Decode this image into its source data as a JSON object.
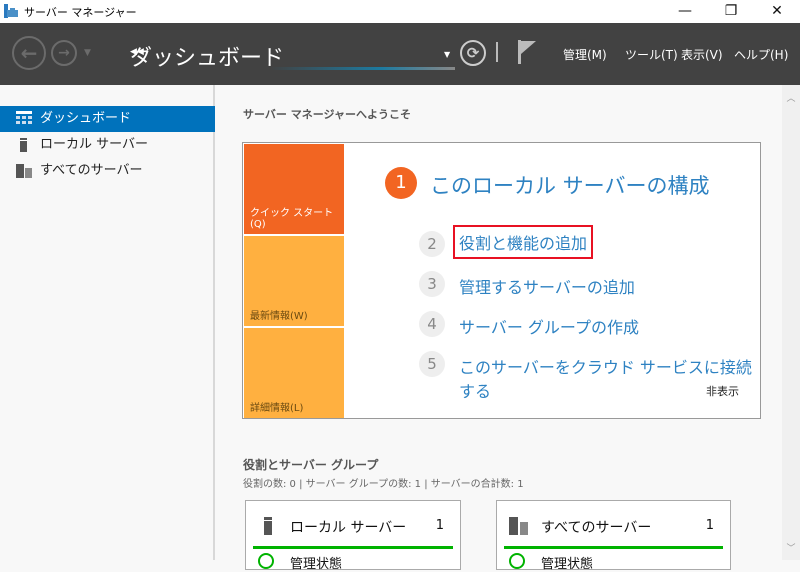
{
  "window": {
    "title": "サーバー マネージャー"
  },
  "toolbar": {
    "breadcrumb": "ダッシュボード",
    "menus": [
      "管理(M)",
      "ツール(T)",
      "表示(V)",
      "ヘルプ(H)"
    ]
  },
  "sidebar": {
    "items": [
      {
        "label": "ダッシュボード"
      },
      {
        "label": "ローカル サーバー"
      },
      {
        "label": "すべてのサーバー"
      }
    ]
  },
  "main": {
    "welcome": "サーバー マネージャーへようこそ",
    "tiles": [
      "クイック スタート(Q)",
      "最新情報(W)",
      "詳細情報(L)"
    ],
    "steps": [
      {
        "n": "1",
        "label": "このローカル サーバーの構成"
      },
      {
        "n": "2",
        "label": "役割と機能の追加"
      },
      {
        "n": "3",
        "label": "管理するサーバーの追加"
      },
      {
        "n": "4",
        "label": "サーバー グループの作成"
      },
      {
        "n": "5",
        "label": "このサーバーをクラウド サービスに接続する"
      }
    ],
    "hide": "非表示",
    "roles_title": "役割とサーバー グループ",
    "roles_sub": "役割の数: 0   |   サーバー グループの数: 1   |   サーバーの合計数: 1",
    "cards": [
      {
        "label": "ローカル サーバー",
        "count": "1",
        "status": "管理状態"
      },
      {
        "label": "すべてのサーバー",
        "count": "1",
        "status": "管理状態"
      }
    ]
  },
  "colors": {
    "accent": "#0072bc",
    "quickstart": "#f26522",
    "tile": "#ffb040",
    "highlight": "#e81123"
  }
}
